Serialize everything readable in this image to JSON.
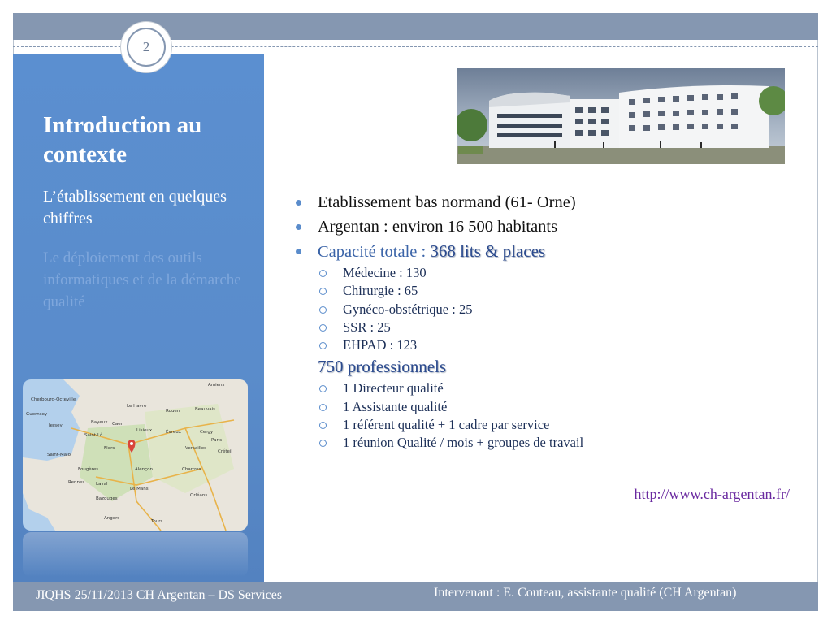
{
  "page_number": "2",
  "sidebar": {
    "title": "Introduction au contexte",
    "items": [
      {
        "label": "L’établissement en quelques chiffres"
      },
      {
        "label": "Le déploiement des outils informatiques et de la démarche qualité"
      }
    ]
  },
  "content": {
    "bullets": [
      "Etablissement bas normand (61- Orne)",
      "Argentan : environ 16 500 habitants"
    ],
    "capacity_label": "Capacité totale : ",
    "capacity_value": "368 lits & places",
    "capacity_items": [
      "Médecine : 130",
      "Chirurgie : 65",
      "Gynéco-obstétrique : 25",
      "SSR : 25",
      "EHPAD : 123"
    ],
    "staff_value": "750 professionnels",
    "staff_items": [
      "1 Directeur qualité",
      "1 Assistante qualité",
      "1 référent qualité + 1 cadre par service",
      "1 réunion Qualité / mois + groupes de travail"
    ],
    "link": "http://www.ch-argentan.fr/"
  },
  "map_labels": [
    "Amiens",
    "Cherbourg-Octeville",
    "Le Havre",
    "Rouen",
    "Beauvais",
    "Guernsey",
    "Jersey",
    "Bayeux",
    "Caen",
    "Saint-Lô",
    "Lisieux",
    "Évreux",
    "Cergy",
    "Saint-Malo",
    "Flers",
    "Paris",
    "Versailles",
    "Créteil",
    "Fougères",
    "Alençon",
    "Rennes",
    "Laval",
    "Chartres",
    "Le Mans",
    "Bazouges",
    "Orléans",
    "Angers",
    "Tours"
  ],
  "footer": {
    "left": "JIQHS 25/11/2013 CH Argentan – DS Services",
    "right": "Intervenant : E. Couteau, assistante qualité (CH Argentan)"
  },
  "colors": {
    "sidebar": "#5b8fd0",
    "band": "#8597b1",
    "accent_text": "#3b64a8",
    "link": "#6a2aa0"
  }
}
